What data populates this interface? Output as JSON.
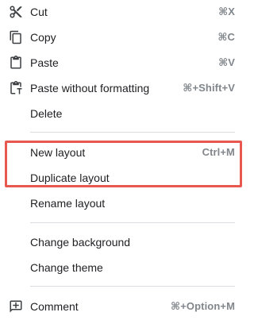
{
  "menu": {
    "items": [
      {
        "label": "Cut",
        "shortcut": "⌘X",
        "icon": "scissors-icon"
      },
      {
        "label": "Copy",
        "shortcut": "⌘C",
        "icon": "copy-icon"
      },
      {
        "label": "Paste",
        "shortcut": "⌘V",
        "icon": "clipboard-icon"
      },
      {
        "label": "Paste without formatting",
        "shortcut": "⌘+Shift+V",
        "icon": "paste-plain-icon"
      },
      {
        "label": "Delete",
        "shortcut": ""
      },
      {
        "label": "New layout",
        "shortcut": "Ctrl+M"
      },
      {
        "label": "Duplicate layout",
        "shortcut": ""
      },
      {
        "label": "Rename layout",
        "shortcut": ""
      },
      {
        "label": "Change background",
        "shortcut": ""
      },
      {
        "label": "Change theme",
        "shortcut": ""
      },
      {
        "label": "Comment",
        "shortcut": "⌘+Option+M",
        "icon": "comment-add-icon"
      }
    ],
    "highlight_color": "#e8584f",
    "shortcut_color": "#80868b",
    "icon_color": "#5f6368"
  }
}
